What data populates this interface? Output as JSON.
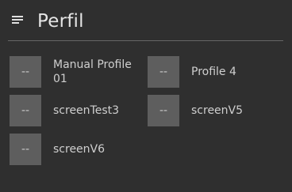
{
  "header": {
    "title": "Perfil",
    "icon": "playlist-menu-icon"
  },
  "profiles": [
    {
      "thumb": "--",
      "name": "Manual Profile\n01"
    },
    {
      "thumb": "--",
      "name": "Profile 4"
    },
    {
      "thumb": "--",
      "name": "screenTest3"
    },
    {
      "thumb": "--",
      "name": "screenV5"
    },
    {
      "thumb": "--",
      "name": "screenV6"
    }
  ],
  "colors": {
    "background": "#2f2f2f",
    "thumbnail": "#5e5e5e",
    "divider": "#666666",
    "text": "#cfcfcf"
  }
}
